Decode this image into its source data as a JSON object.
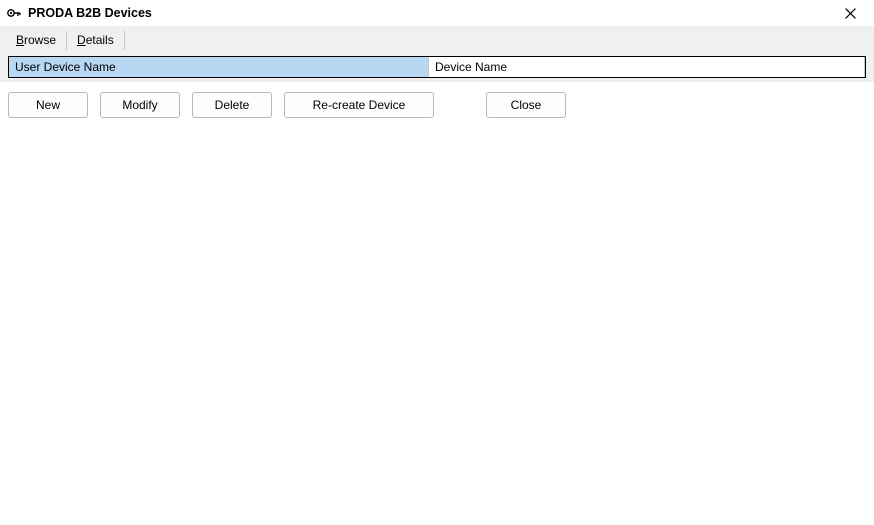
{
  "window": {
    "title": "PRODA B2B Devices"
  },
  "tabs": {
    "browse": "Browse",
    "details": "Details"
  },
  "grid": {
    "columns": {
      "user_device_name": "User Device Name",
      "device_name": "Device Name"
    }
  },
  "buttons": {
    "new": "New",
    "modify": "Modify",
    "delete": "Delete",
    "recreate": "Re-create Device",
    "close": "Close"
  }
}
